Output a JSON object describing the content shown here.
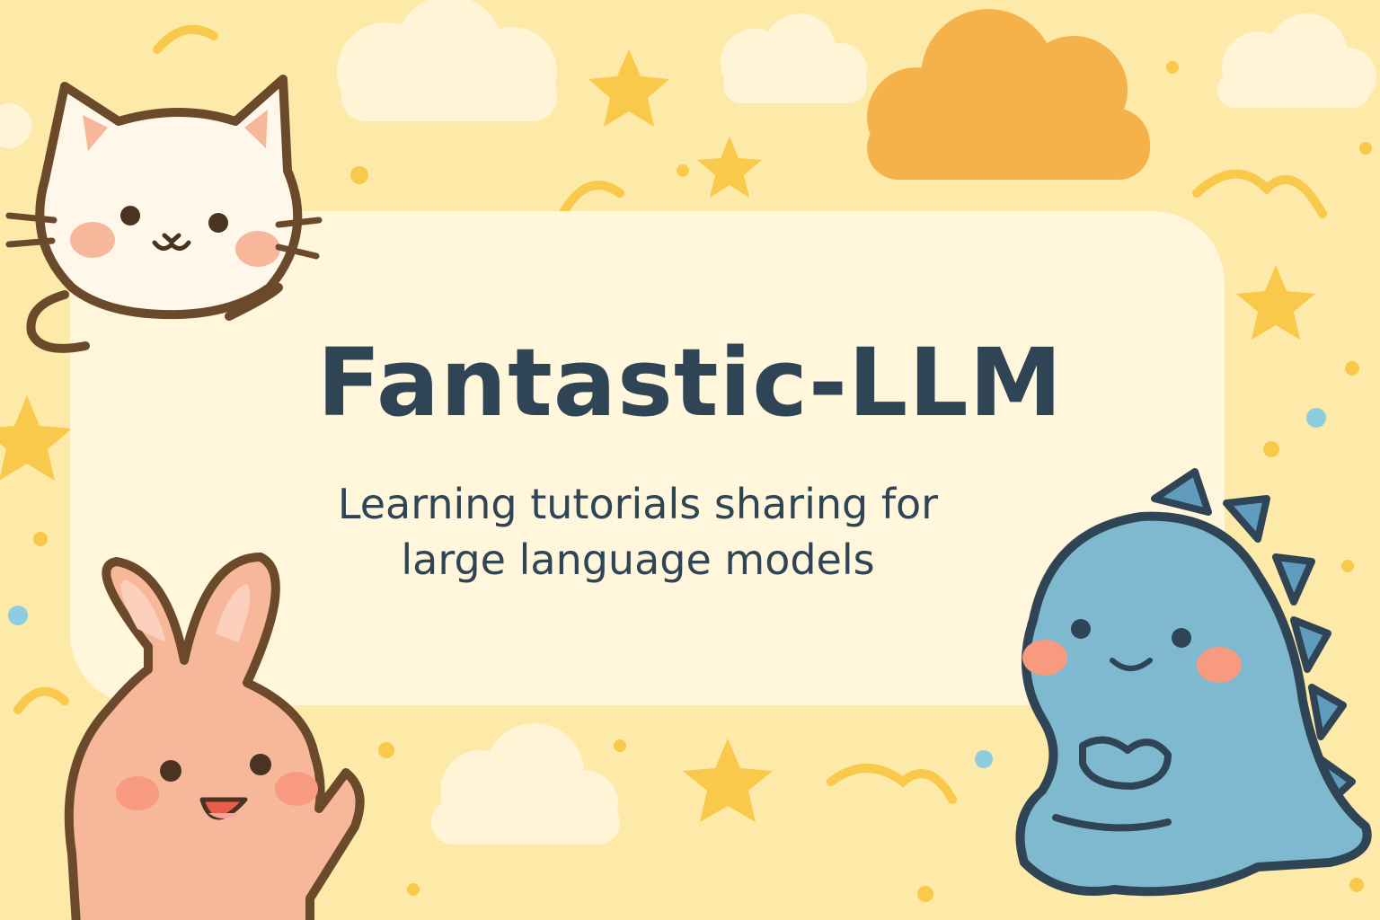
{
  "banner": {
    "title": "Fantastic-LLM",
    "subtitle_line1": "Learning tutorials sharing for",
    "subtitle_line2": "large language models"
  },
  "colors": {
    "background": "#fde9a8",
    "panel": "#fff6dc",
    "text": "#2f4454",
    "outline": "#6b4a2b",
    "cat_fill": "#fff8ea",
    "bunny_fill": "#f7b79a",
    "dino_fill": "#7fb9cf",
    "dino_outline": "#2f4454",
    "star": "#f8c94a",
    "orange_cloud": "#f6b24a",
    "white_cloud": "#fff4d6",
    "blush": "#f79a80"
  },
  "characters": [
    "cat-icon",
    "bunny-icon",
    "dinosaur-icon"
  ],
  "decorations": [
    "star-icon",
    "cloud-icon",
    "dot-icon",
    "swirl-icon"
  ]
}
